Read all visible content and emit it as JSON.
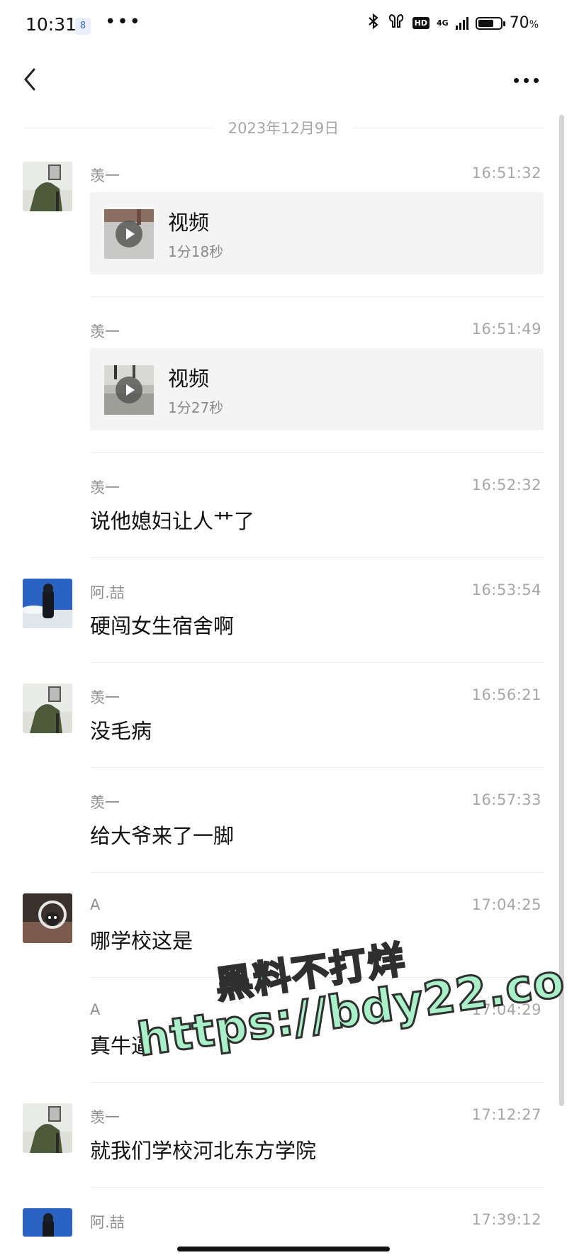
{
  "status_bar": {
    "time": "10:31",
    "notification_badge": "8",
    "overflow_dots": "•••",
    "network_label": "4G",
    "hd_label": "HD",
    "battery_percent": "70",
    "battery_unit": "%",
    "battery_level": 0.7,
    "icons": [
      "bluetooth-icon",
      "earbuds-icon",
      "hd-icon",
      "signal-icon",
      "battery-icon"
    ]
  },
  "nav": {
    "back_icon": "chevron-left-icon",
    "more_icon": "more-horizontal-icon"
  },
  "date_separator": "2023年12月9日",
  "messages": [
    {
      "sender": "羡一",
      "time": "16:51:32",
      "type": "video",
      "video_title": "视频",
      "video_duration": "1分18秒",
      "show_avatar": true,
      "avatar": "avatar-green-figure"
    },
    {
      "sender": "羡一",
      "time": "16:51:49",
      "type": "video",
      "video_title": "视频",
      "video_duration": "1分27秒",
      "show_avatar": false
    },
    {
      "sender": "羡一",
      "time": "16:52:32",
      "type": "text",
      "text": "说他媳妇让人艹了",
      "show_avatar": false
    },
    {
      "sender": "阿.喆",
      "time": "16:53:54",
      "type": "text",
      "text": "硬闯女生宿舍啊",
      "show_avatar": true,
      "avatar": "avatar-blue-sky"
    },
    {
      "sender": "羡一",
      "time": "16:56:21",
      "type": "text",
      "text": "没毛病",
      "show_avatar": true,
      "avatar": "avatar-green-figure"
    },
    {
      "sender": "羡一",
      "time": "16:57:33",
      "type": "text",
      "text": "给大爷来了一脚",
      "show_avatar": false
    },
    {
      "sender": "A",
      "time": "17:04:25",
      "type": "text",
      "text": "哪学校这是",
      "show_avatar": true,
      "avatar": "avatar-headphones"
    },
    {
      "sender": "A",
      "time": "17:04:29",
      "type": "text",
      "text": "真牛逼",
      "show_avatar": false
    },
    {
      "sender": "羡一",
      "time": "17:12:27",
      "type": "text",
      "text": "就我们学校河北东方学院",
      "show_avatar": true,
      "avatar": "avatar-green-figure"
    },
    {
      "sender": "阿.喆",
      "time": "17:39:12",
      "type": "text",
      "text": "",
      "show_avatar": true,
      "avatar": "avatar-blue-sky"
    }
  ],
  "watermark": {
    "line1": "黑料不打烊",
    "line2": "https://bdy22.co",
    "fill_color": "#a8f0c8",
    "stroke_color": "#2f2f2f"
  },
  "colors": {
    "background": "#ffffff",
    "sender_text": "#8e8e8e",
    "time_text": "#a7a7a7",
    "video_card_bg": "#f4f4f4"
  }
}
